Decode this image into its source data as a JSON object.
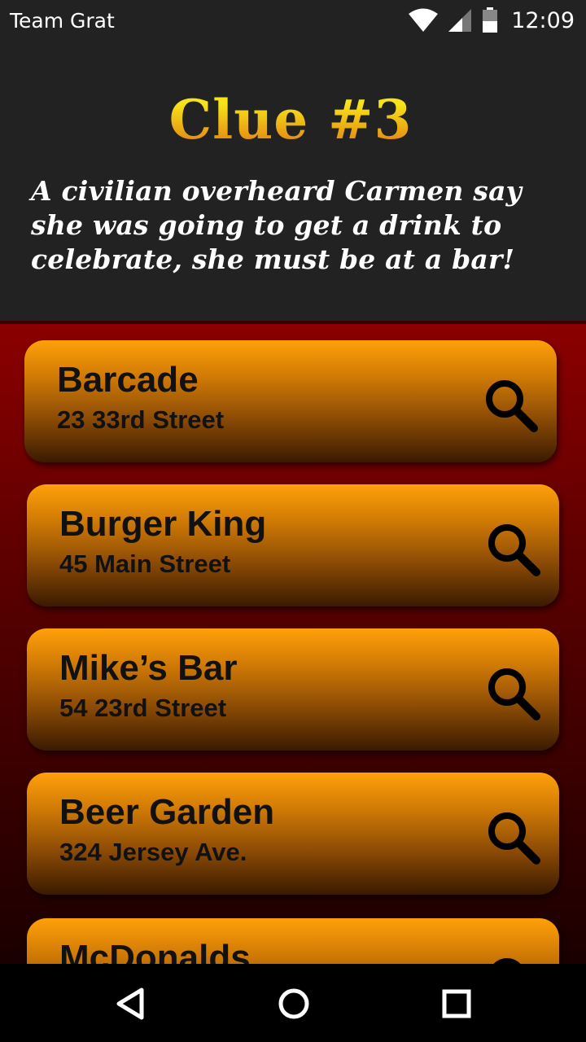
{
  "status_bar": {
    "carrier": "Team Grat",
    "time": "12:09",
    "icons": [
      "wifi-icon",
      "cell-signal-icon",
      "battery-icon"
    ]
  },
  "clue": {
    "title": "Clue #3",
    "text": "A civilian overheard Carmen say she was going to get a drink to celebrate, she must be at a bar!"
  },
  "locations": [
    {
      "name": "Barcade",
      "address": "23 33rd Street"
    },
    {
      "name": "Burger King",
      "address": "45 Main Street"
    },
    {
      "name": "Mike’s Bar",
      "address": "54 23rd Street"
    },
    {
      "name": "Beer Garden",
      "address": "324 Jersey Ave."
    },
    {
      "name": "McDonalds",
      "address": ""
    }
  ],
  "nav": {
    "icons": [
      "back-icon",
      "home-icon",
      "recents-icon"
    ]
  },
  "colors": {
    "header_bg": "#222222",
    "title_gradient_top": "#f7e31a",
    "title_gradient_bottom": "#e07d10",
    "list_bg_top": "#8c0000",
    "card_orange": "#ffa00a"
  }
}
